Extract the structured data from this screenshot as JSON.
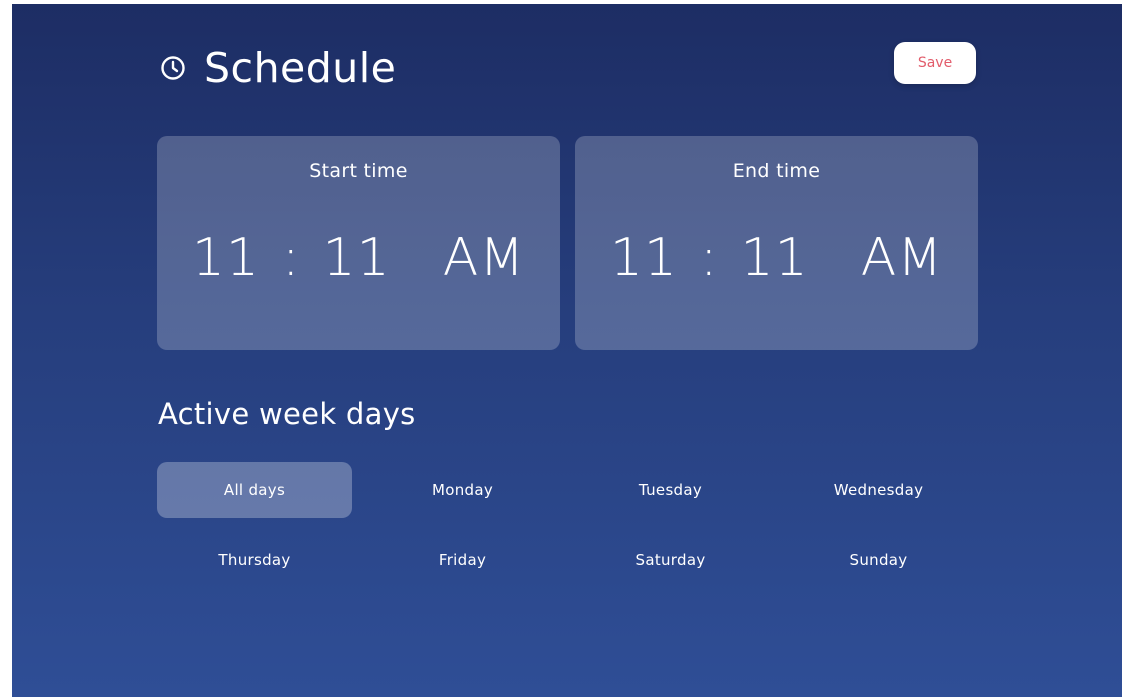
{
  "header": {
    "icon": "clock-icon",
    "title": "Schedule",
    "save_label": "Save"
  },
  "start_time": {
    "label": "Start time",
    "hour": "11",
    "separator": ":",
    "minute": "11",
    "period": "AM"
  },
  "end_time": {
    "label": "End time",
    "hour": "11",
    "separator": ":",
    "minute": "11",
    "period": "AM"
  },
  "weekdays": {
    "title": "Active week days",
    "options": [
      {
        "label": "All days",
        "selected": true
      },
      {
        "label": "Monday",
        "selected": false
      },
      {
        "label": "Tuesday",
        "selected": false
      },
      {
        "label": "Wednesday",
        "selected": false
      },
      {
        "label": "Thursday",
        "selected": false
      },
      {
        "label": "Friday",
        "selected": false
      },
      {
        "label": "Saturday",
        "selected": false
      },
      {
        "label": "Sunday",
        "selected": false
      }
    ]
  },
  "colors": {
    "background_top": "#1d2d64",
    "background_bottom": "#2f4e96",
    "save_text": "#e25c6b"
  }
}
